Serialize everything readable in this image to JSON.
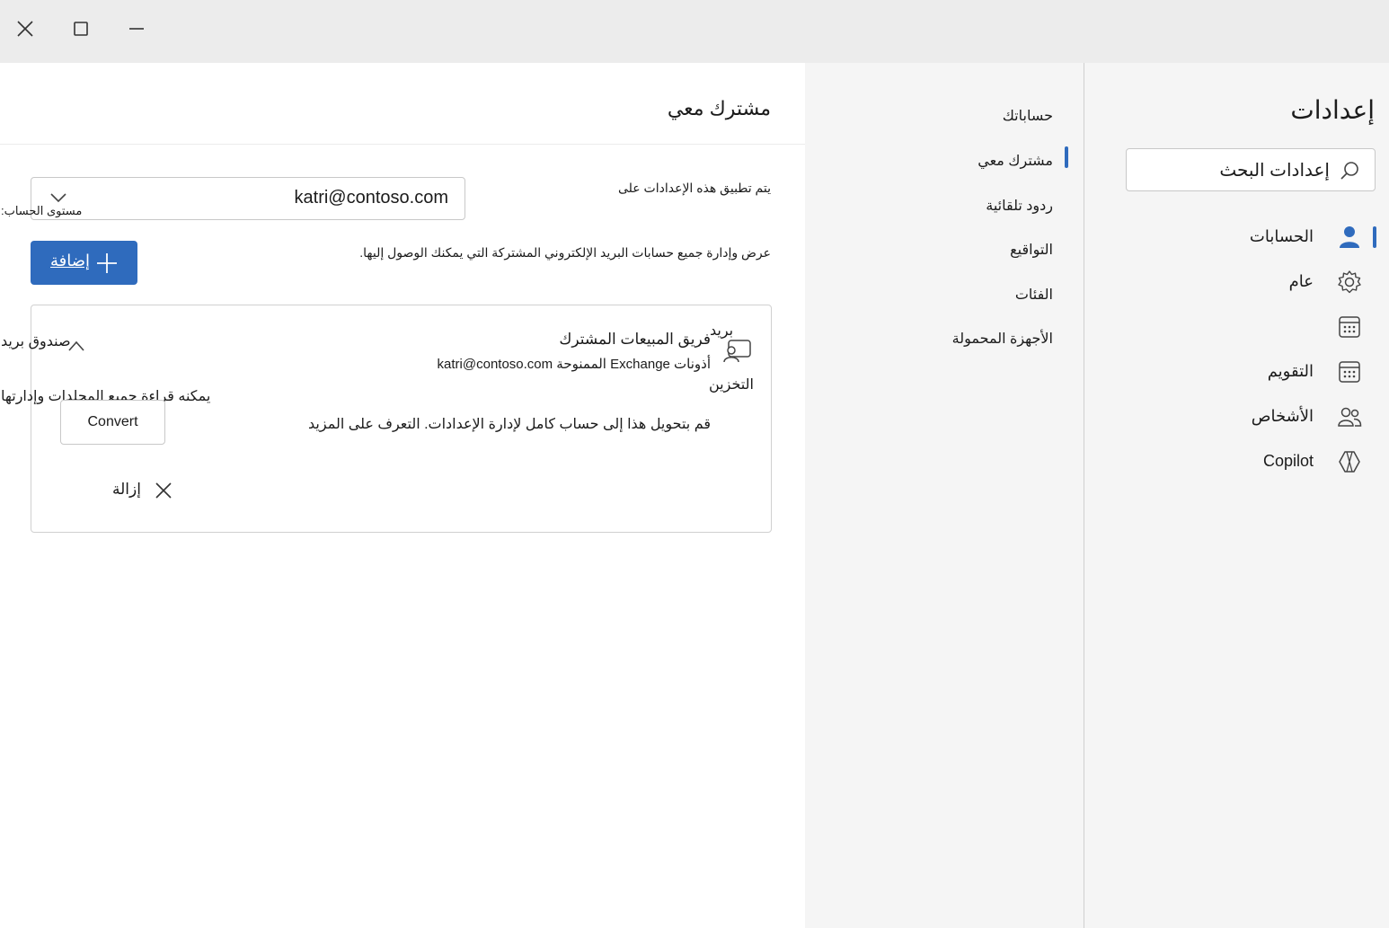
{
  "window": {
    "close_icon": "close-icon",
    "maximize_icon": "maximize-icon",
    "minimize_icon": "minimize-icon"
  },
  "sidebar": {
    "title": "إعدادات",
    "search_placeholder": "إعدادات البحث",
    "items": [
      {
        "label": "الحسابات",
        "icon": "person-icon",
        "selected": true
      },
      {
        "label": "عام",
        "icon": "gear-icon"
      },
      {
        "label": "",
        "icon": "calendar-grid-icon"
      },
      {
        "label": "التقويم",
        "icon": "calendar-icon"
      },
      {
        "label": "الأشخاص",
        "icon": "people-icon"
      },
      {
        "label": "Copilot",
        "icon": "copilot-icon"
      }
    ]
  },
  "subnav": {
    "items": [
      {
        "label": "حساباتك"
      },
      {
        "label": "مشترك معي",
        "selected": true
      },
      {
        "label": "ردود تلقائية"
      },
      {
        "label": "التواقيع"
      },
      {
        "label": "الفئات"
      },
      {
        "label": "الأجهزة المحمولة"
      }
    ]
  },
  "main": {
    "title": "مشترك معي",
    "apply_label": "يتم تطبيق هذه الإعدادات على",
    "account_select_value": "katri@contoso.com",
    "account_level_label": "مستوى الحساب:",
    "description": "عرض وإدارة جميع حسابات البريد الإلكتروني المشتركة التي يمكنك الوصول إليها.",
    "add_button": "إضافة",
    "card": {
      "type_label": "بريد",
      "name": "فريق المبيعات المشترك",
      "permissions": "أذونات Exchange الممنوحة katri@contoso.com",
      "storage_label": "التخزين",
      "left_title": "صندوق بريد",
      "read_write": "يمكنه قراءة جميع المجلدات وإدارتها",
      "convert_text": "قم بتحويل هذا إلى حساب كامل لإدارة الإعدادات. التعرف على المزيد",
      "convert_button": "Convert",
      "remove_label": "إزالة"
    }
  }
}
